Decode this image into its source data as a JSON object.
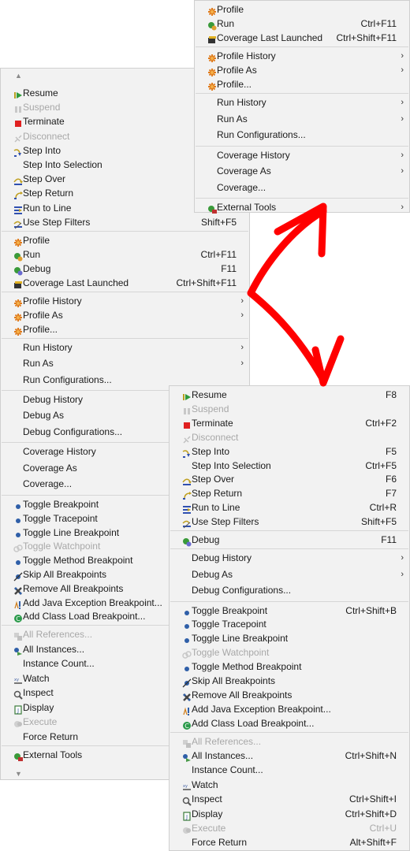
{
  "colors": {
    "menu_bg": "#f2f2f2",
    "separator": "#d6d6d6",
    "disabled": "#a8a8a8",
    "annotation": "#ff0000"
  },
  "scroll": {
    "up": "▲",
    "down": "▼"
  },
  "menus": {
    "top_right": [
      {
        "label": "Profile",
        "icon": "profile-icon"
      },
      {
        "label": "Run",
        "accel": "Ctrl+F11",
        "icon": "run-icon"
      },
      {
        "label": "Coverage Last Launched",
        "accel": "Ctrl+Shift+F11",
        "icon": "coverage-icon"
      },
      {
        "sep": true
      },
      {
        "label": "Profile History",
        "submenu": true,
        "icon": "profile-icon"
      },
      {
        "label": "Profile As",
        "submenu": true,
        "icon": "profile-icon"
      },
      {
        "label": "Profile...",
        "icon": "profile-icon"
      },
      {
        "sep": true
      },
      {
        "label": "Run History",
        "submenu": true
      },
      {
        "label": "Run As",
        "submenu": true
      },
      {
        "label": "Run Configurations..."
      },
      {
        "sep": true
      },
      {
        "label": "Coverage History",
        "submenu": true
      },
      {
        "label": "Coverage As",
        "submenu": true
      },
      {
        "label": "Coverage..."
      },
      {
        "sep": true
      },
      {
        "label": "External Tools",
        "submenu": true,
        "icon": "external-tools-icon"
      }
    ],
    "left": [
      {
        "label": "Resume",
        "icon": "resume-icon"
      },
      {
        "label": "Suspend",
        "disabled": true,
        "icon": "suspend-icon"
      },
      {
        "label": "Terminate",
        "icon": "terminate-icon"
      },
      {
        "label": "Disconnect",
        "disabled": true,
        "icon": "disconnect-icon"
      },
      {
        "label": "Step Into",
        "icon": "step-into-icon"
      },
      {
        "label": "Step Into Selection"
      },
      {
        "label": "Step Over",
        "icon": "step-over-icon"
      },
      {
        "label": "Step Return",
        "icon": "step-return-icon"
      },
      {
        "label": "Run to Line",
        "icon": "run-to-line-icon"
      },
      {
        "label": "Use Step Filters",
        "accel": "Shift+F5",
        "icon": "step-filters-icon"
      },
      {
        "sep": true
      },
      {
        "label": "Profile",
        "icon": "profile-icon"
      },
      {
        "label": "Run",
        "accel": "Ctrl+F11",
        "icon": "run-icon"
      },
      {
        "label": "Debug",
        "accel": "F11",
        "icon": "debug-icon"
      },
      {
        "label": "Coverage Last Launched",
        "accel": "Ctrl+Shift+F11",
        "icon": "coverage-icon"
      },
      {
        "sep": true
      },
      {
        "label": "Profile History",
        "submenu": true,
        "icon": "profile-icon"
      },
      {
        "label": "Profile As",
        "submenu": true,
        "icon": "profile-icon"
      },
      {
        "label": "Profile...",
        "icon": "profile-icon"
      },
      {
        "sep": true
      },
      {
        "label": "Run History",
        "submenu": true
      },
      {
        "label": "Run As",
        "submenu": true
      },
      {
        "label": "Run Configurations..."
      },
      {
        "sep": true
      },
      {
        "label": "Debug History"
      },
      {
        "label": "Debug As"
      },
      {
        "label": "Debug Configurations..."
      },
      {
        "sep": true
      },
      {
        "label": "Coverage History"
      },
      {
        "label": "Coverage As"
      },
      {
        "label": "Coverage..."
      },
      {
        "sep": true
      },
      {
        "label": "Toggle Breakpoint",
        "icon": "breakpoint-icon"
      },
      {
        "label": "Toggle Tracepoint",
        "icon": "breakpoint-icon"
      },
      {
        "label": "Toggle Line Breakpoint",
        "icon": "breakpoint-icon"
      },
      {
        "label": "Toggle Watchpoint",
        "disabled": true,
        "icon": "watchpoint-icon"
      },
      {
        "label": "Toggle Method Breakpoint",
        "icon": "breakpoint-icon"
      },
      {
        "label": "Skip All Breakpoints",
        "icon": "skip-breakpoints-icon"
      },
      {
        "label": "Remove All Breakpoints",
        "icon": "remove-breakpoints-icon"
      },
      {
        "label": "Add Java Exception Breakpoint...",
        "icon": "exception-breakpoint-icon"
      },
      {
        "label": "Add Class Load Breakpoint...",
        "icon": "class-load-icon"
      },
      {
        "sep": true
      },
      {
        "label": "All References...",
        "disabled": true,
        "icon": "references-icon"
      },
      {
        "label": "All Instances...",
        "icon": "instances-icon"
      },
      {
        "label": "Instance Count..."
      },
      {
        "label": "Watch",
        "icon": "watch-icon"
      },
      {
        "label": "Inspect",
        "icon": "inspect-icon"
      },
      {
        "label": "Display",
        "icon": "display-icon"
      },
      {
        "label": "Execute",
        "disabled": true,
        "icon": "execute-icon"
      },
      {
        "label": "Force Return"
      },
      {
        "sep": true
      },
      {
        "label": "External Tools",
        "icon": "external-tools-icon"
      }
    ],
    "bottom_right": [
      {
        "label": "Resume",
        "accel": "F8",
        "icon": "resume-icon"
      },
      {
        "label": "Suspend",
        "disabled": true,
        "icon": "suspend-icon"
      },
      {
        "label": "Terminate",
        "accel": "Ctrl+F2",
        "icon": "terminate-icon"
      },
      {
        "label": "Disconnect",
        "disabled": true,
        "icon": "disconnect-icon"
      },
      {
        "label": "Step Into",
        "accel": "F5",
        "icon": "step-into-icon"
      },
      {
        "label": "Step Into Selection",
        "accel": "Ctrl+F5"
      },
      {
        "label": "Step Over",
        "accel": "F6",
        "icon": "step-over-icon"
      },
      {
        "label": "Step Return",
        "accel": "F7",
        "icon": "step-return-icon"
      },
      {
        "label": "Run to Line",
        "accel": "Ctrl+R",
        "icon": "run-to-line-icon"
      },
      {
        "label": "Use Step Filters",
        "accel": "Shift+F5",
        "icon": "step-filters-icon"
      },
      {
        "sep": true
      },
      {
        "label": "Debug",
        "accel": "F11",
        "icon": "debug-icon"
      },
      {
        "sep": true
      },
      {
        "label": "Debug History",
        "submenu": true
      },
      {
        "label": "Debug As",
        "submenu": true
      },
      {
        "label": "Debug Configurations..."
      },
      {
        "sep": true
      },
      {
        "label": "Toggle Breakpoint",
        "accel": "Ctrl+Shift+B",
        "icon": "breakpoint-icon"
      },
      {
        "label": "Toggle Tracepoint",
        "icon": "breakpoint-icon"
      },
      {
        "label": "Toggle Line Breakpoint",
        "icon": "breakpoint-icon"
      },
      {
        "label": "Toggle Watchpoint",
        "disabled": true,
        "icon": "watchpoint-icon"
      },
      {
        "label": "Toggle Method Breakpoint",
        "icon": "breakpoint-icon"
      },
      {
        "label": "Skip All Breakpoints",
        "icon": "skip-breakpoints-icon"
      },
      {
        "label": "Remove All Breakpoints",
        "icon": "remove-breakpoints-icon"
      },
      {
        "label": "Add Java Exception Breakpoint...",
        "icon": "exception-breakpoint-icon"
      },
      {
        "label": "Add Class Load Breakpoint...",
        "icon": "class-load-icon"
      },
      {
        "sep": true
      },
      {
        "label": "All References...",
        "disabled": true,
        "icon": "references-icon"
      },
      {
        "label": "All Instances...",
        "accel": "Ctrl+Shift+N",
        "icon": "instances-icon"
      },
      {
        "label": "Instance Count..."
      },
      {
        "label": "Watch",
        "icon": "watch-icon"
      },
      {
        "label": "Inspect",
        "accel": "Ctrl+Shift+I",
        "icon": "inspect-icon"
      },
      {
        "label": "Display",
        "accel": "Ctrl+Shift+D",
        "icon": "display-icon"
      },
      {
        "label": "Execute",
        "accel": "Ctrl+U",
        "disabled": true,
        "icon": "execute-icon"
      },
      {
        "label": "Force Return",
        "accel": "Alt+Shift+F"
      }
    ]
  }
}
